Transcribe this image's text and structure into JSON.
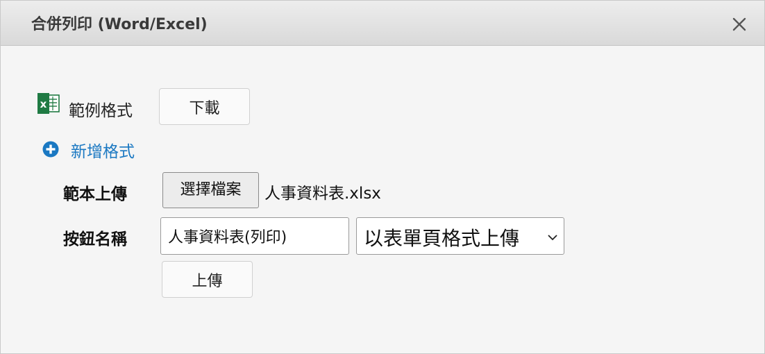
{
  "dialog": {
    "title": "合併列印 (Word/Excel)"
  },
  "sample": {
    "label": "範例格式",
    "download_label": "下載",
    "icon": "excel-icon"
  },
  "add_format": {
    "label": "新增格式",
    "icon": "plus-circle-icon"
  },
  "template_upload": {
    "label": "範本上傳",
    "choose_file_label": "選擇檔案",
    "file_name": "人事資料表.xlsx"
  },
  "button_name": {
    "label": "按鈕名稱",
    "input_value": "人事資料表(列印)",
    "select_value": "以表單頁格式上傳"
  },
  "upload": {
    "label": "上傳"
  },
  "colors": {
    "link": "#1a78c2",
    "excel_green": "#1f7a43"
  }
}
